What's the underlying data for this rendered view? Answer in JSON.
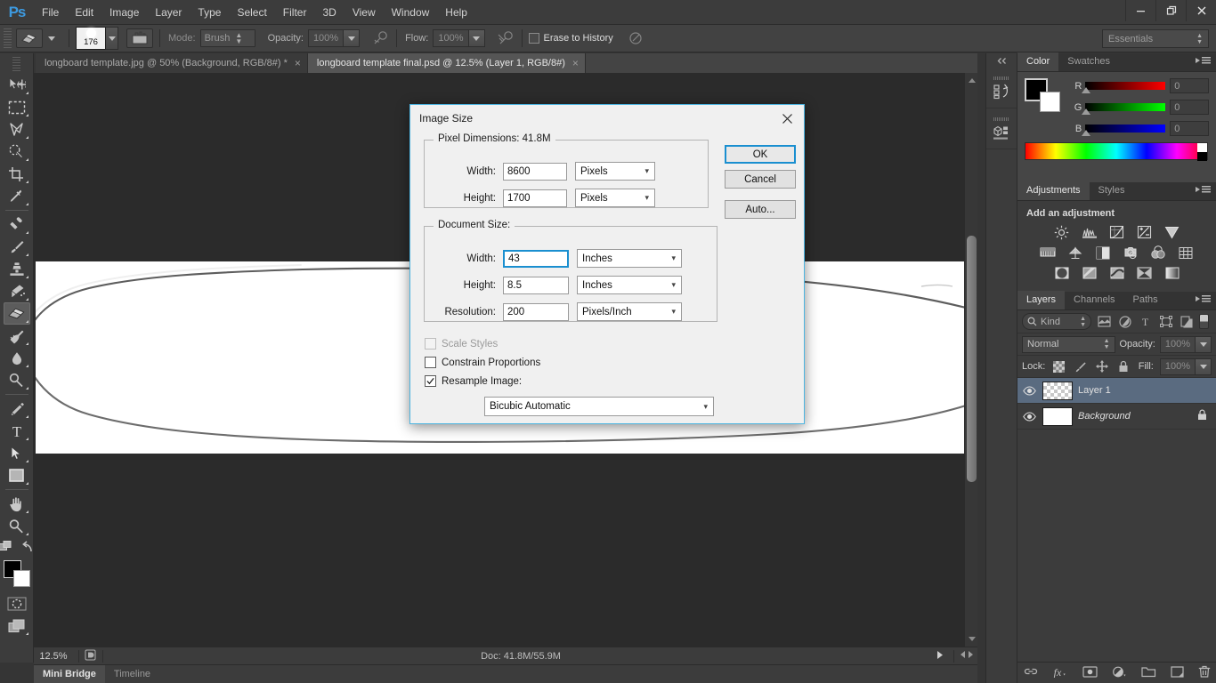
{
  "app": {
    "logo": "Ps"
  },
  "menubar": {
    "items": [
      "File",
      "Edit",
      "Image",
      "Layer",
      "Type",
      "Select",
      "Filter",
      "3D",
      "View",
      "Window",
      "Help"
    ],
    "window_controls": {
      "minimize": "—",
      "restore": "❐",
      "close": "✕"
    }
  },
  "options_bar": {
    "tool": "eraser-tool",
    "brush_size": "176",
    "mode_label": "Mode:",
    "mode_value": "Brush",
    "opacity_label": "Opacity:",
    "opacity_value": "100%",
    "flow_label": "Flow:",
    "flow_value": "100%",
    "erase_to_history_label": "Erase to History",
    "erase_to_history_checked": false,
    "workspace": "Essentials"
  },
  "tabs": [
    {
      "label": "longboard template.jpg @ 50% (Background, RGB/8#) *",
      "active": false,
      "close": "×"
    },
    {
      "label": "longboard template final.psd @ 12.5% (Layer 1, RGB/8#)",
      "active": true,
      "close": "×"
    }
  ],
  "toolbar": {
    "tools": [
      {
        "name": "move-tool",
        "selected": false
      },
      {
        "name": "rectangular-marquee-tool",
        "selected": false
      },
      {
        "name": "lasso-tool",
        "selected": false
      },
      {
        "name": "quick-selection-tool",
        "selected": false
      },
      {
        "name": "crop-tool",
        "selected": false
      },
      {
        "name": "eyedropper-tool",
        "selected": false
      },
      {
        "name": "spot-healing-brush-tool",
        "selected": false
      },
      {
        "name": "brush-tool",
        "selected": false
      },
      {
        "name": "clone-stamp-tool",
        "selected": false
      },
      {
        "name": "history-brush-tool",
        "selected": false
      },
      {
        "name": "eraser-tool",
        "selected": true
      },
      {
        "name": "gradient-tool",
        "selected": false
      },
      {
        "name": "blur-tool",
        "selected": false
      },
      {
        "name": "dodge-tool",
        "selected": false
      },
      {
        "name": "pen-tool",
        "selected": false
      },
      {
        "name": "horizontal-type-tool",
        "selected": false
      },
      {
        "name": "path-selection-tool",
        "selected": false
      },
      {
        "name": "rectangle-tool",
        "selected": false
      },
      {
        "name": "hand-tool",
        "selected": false
      },
      {
        "name": "zoom-tool",
        "selected": false
      }
    ],
    "foreground_color": "#000000",
    "background_color": "#ffffff"
  },
  "dialog": {
    "title": "Image Size",
    "close": "✕",
    "pixel_dimensions": {
      "legend": "Pixel Dimensions:  41.8M",
      "width_label": "Width:",
      "width_value": "8600",
      "width_unit": "Pixels",
      "height_label": "Height:",
      "height_value": "1700",
      "height_unit": "Pixels"
    },
    "document_size": {
      "legend": "Document Size:",
      "width_label": "Width:",
      "width_value": "43",
      "width_unit": "Inches",
      "height_label": "Height:",
      "height_value": "8.5",
      "height_unit": "Inches",
      "resolution_label": "Resolution:",
      "resolution_value": "200",
      "resolution_unit": "Pixels/Inch"
    },
    "scale_styles_label": "Scale Styles",
    "scale_styles_checked": false,
    "scale_styles_disabled": true,
    "constrain_proportions_label": "Constrain Proportions",
    "constrain_proportions_checked": false,
    "resample_image_label": "Resample Image:",
    "resample_image_checked": true,
    "resample_method": "Bicubic Automatic",
    "buttons": {
      "ok": "OK",
      "cancel": "Cancel",
      "auto": "Auto..."
    }
  },
  "color_panel": {
    "tabs": [
      "Color",
      "Swatches"
    ],
    "active_tab": "Color",
    "channels": [
      {
        "label": "R",
        "value": "0",
        "color": "#ff0000"
      },
      {
        "label": "G",
        "value": "0",
        "color": "#00ff00"
      },
      {
        "label": "B",
        "value": "0",
        "color": "#0000ff"
      }
    ]
  },
  "adjustments_panel": {
    "tabs": [
      "Adjustments",
      "Styles"
    ],
    "active_tab": "Adjustments",
    "title": "Add an adjustment",
    "icons": [
      [
        "brightness-contrast-icon",
        "levels-icon",
        "curves-icon",
        "exposure-icon",
        "vibrance-icon"
      ],
      [
        "hue-saturation-icon",
        "color-balance-icon",
        "black-white-icon",
        "photo-filter-icon",
        "channel-mixer-icon",
        "color-lookup-icon"
      ],
      [
        "invert-icon",
        "posterize-icon",
        "threshold-icon",
        "selective-color-icon",
        "gradient-map-icon"
      ]
    ]
  },
  "layers_panel": {
    "tabs": [
      "Layers",
      "Channels",
      "Paths"
    ],
    "active_tab": "Layers",
    "filter_label": "Kind",
    "blend_mode": "Normal",
    "opacity_label": "Opacity:",
    "opacity_value": "100%",
    "lock_label": "Lock:",
    "fill_label": "Fill:",
    "fill_value": "100%",
    "layers": [
      {
        "name": "Layer 1",
        "selected": true,
        "visible": true,
        "locked": false,
        "italic": false,
        "thumb": "checker"
      },
      {
        "name": "Background",
        "selected": false,
        "visible": true,
        "locked": true,
        "italic": true,
        "thumb": "white"
      }
    ],
    "bottom_icons": [
      "link-layers-icon",
      "layer-style-icon",
      "layer-mask-icon",
      "new-fill-adjustment-icon",
      "new-group-icon",
      "new-layer-icon",
      "delete-layer-icon"
    ]
  },
  "status_bar": {
    "zoom": "12.5%",
    "doc_info": "Doc: 41.8M/55.9M"
  },
  "bottom_tabs": [
    {
      "label": "Mini Bridge",
      "active": true
    },
    {
      "label": "Timeline",
      "active": false
    }
  ]
}
